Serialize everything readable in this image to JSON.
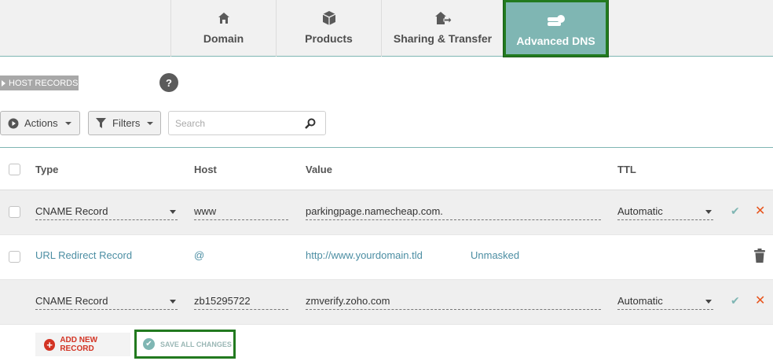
{
  "tabs": [
    {
      "label": "Domain",
      "icon": "home-icon"
    },
    {
      "label": "Products",
      "icon": "box-icon"
    },
    {
      "label": "Sharing & Transfer",
      "icon": "transfer-icon"
    },
    {
      "label": "Advanced DNS",
      "icon": "dns-server-icon",
      "active": true
    }
  ],
  "section": {
    "label": "HOST RECORDS",
    "help": "?"
  },
  "toolbar": {
    "actions_label": "Actions",
    "filters_label": "Filters",
    "search_placeholder": "Search"
  },
  "table": {
    "headers": {
      "type": "Type",
      "host": "Host",
      "value": "Value",
      "ttl": "TTL"
    },
    "rows": [
      {
        "type": "CNAME Record",
        "host": "www",
        "value": "parkingpage.namecheap.com.",
        "ttl": "Automatic"
      },
      {
        "type": "URL Redirect Record",
        "host": "@",
        "value": "http://www.yourdomain.tld",
        "extra": "Unmasked"
      },
      {
        "type": "CNAME Record",
        "host": "zb15295722",
        "value": "zmverify.zoho.com",
        "ttl": "Automatic"
      }
    ]
  },
  "footer": {
    "add_label": "ADD NEW RECORD",
    "save_label": "SAVE ALL CHANGES"
  },
  "colors": {
    "accent": "#7fb6b3",
    "highlight": "#227a1f",
    "danger": "#e8541c"
  }
}
